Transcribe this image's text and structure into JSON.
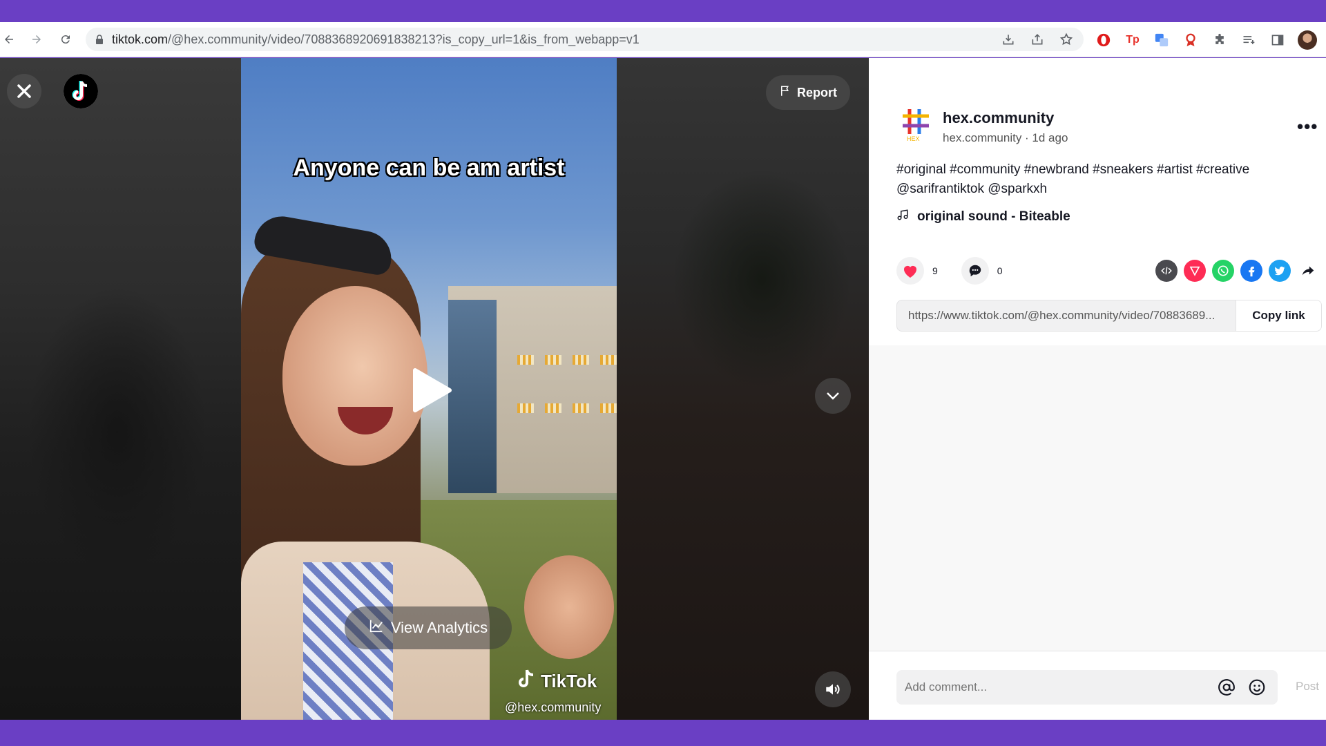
{
  "browser": {
    "url_host": "tiktok.com",
    "url_path": "/@hex.community/video/7088368920691838213?is_copy_url=1&is_from_webapp=v1"
  },
  "video": {
    "caption": "Anyone can be am artist",
    "view_analytics_label": "View Analytics",
    "watermark_brand": "TikTok",
    "watermark_handle": "@hex.community",
    "report_label": "Report"
  },
  "post": {
    "author_name": "hex.community",
    "author_meta": "hex.community · 1d ago",
    "description_line1": "#original #community #newbrand #sneakers #artist #creative",
    "description_line2": "@sarifrantiktok @sparkxh",
    "sound": "original sound - Biteable",
    "likes": "9",
    "comments": "0",
    "link": "https://www.tiktok.com/@hex.community/video/70883689...",
    "copy_link_label": "Copy link"
  },
  "comment": {
    "placeholder": "Add comment...",
    "post_label": "Post"
  },
  "colors": {
    "accent": "#fe2c55",
    "frame": "#6a3fc4"
  }
}
